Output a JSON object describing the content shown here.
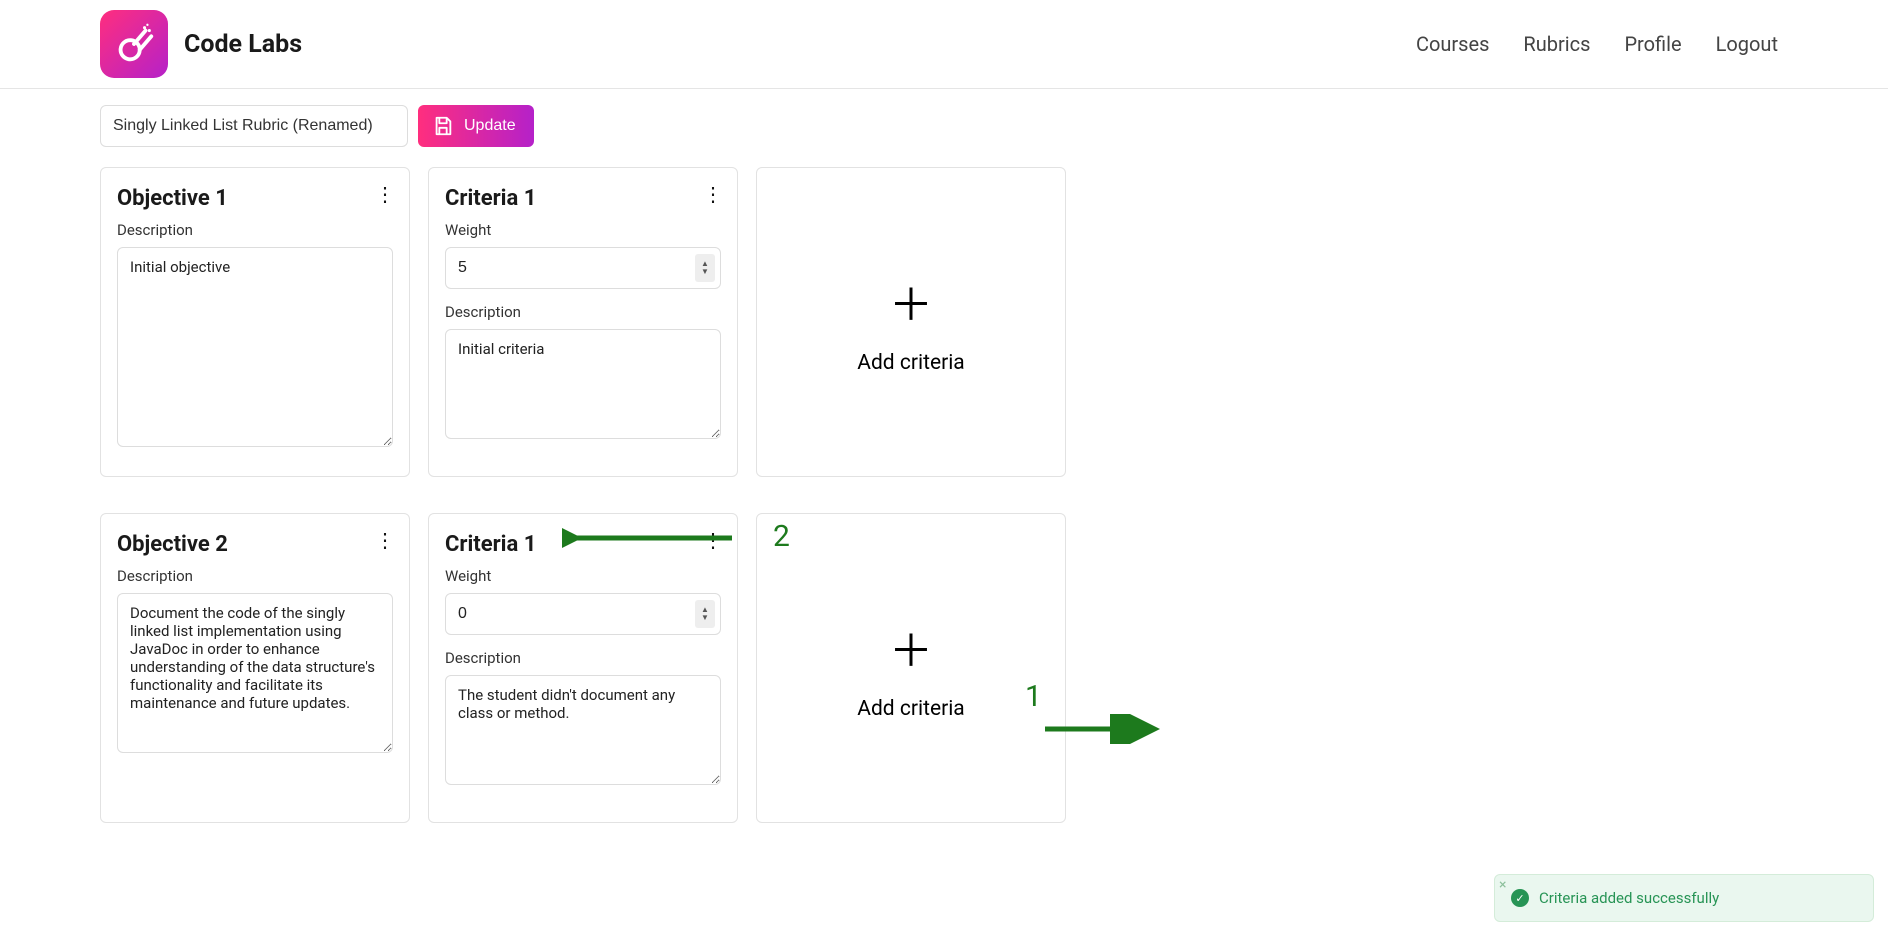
{
  "brand": {
    "name": "Code Labs"
  },
  "nav": {
    "courses": "Courses",
    "rubrics": "Rubrics",
    "profile": "Profile",
    "logout": "Logout"
  },
  "toolbar": {
    "rubric_name": "Singly Linked List Rubric (Renamed)",
    "update_label": "Update"
  },
  "rows": [
    {
      "objective": {
        "title": "Objective 1",
        "description_label": "Description",
        "description": "Initial objective"
      },
      "criteria": {
        "title": "Criteria 1",
        "weight_label": "Weight",
        "weight": "5",
        "description_label": "Description",
        "description": "Initial criteria"
      },
      "add_label": "Add criteria"
    },
    {
      "objective": {
        "title": "Objective 2",
        "description_label": "Description",
        "description": "Document the code of the singly linked list implementation using JavaDoc in order to enhance understanding of the data structure's functionality and facilitate its maintenance and future updates."
      },
      "criteria": {
        "title": "Criteria 1",
        "weight_label": "Weight",
        "weight": "0",
        "description_label": "Description",
        "description": "The student didn't document any class or method."
      },
      "add_label": "Add criteria"
    }
  ],
  "annotations": {
    "num1": "1",
    "num2": "2"
  },
  "toast": {
    "message": "Criteria added successfully"
  }
}
